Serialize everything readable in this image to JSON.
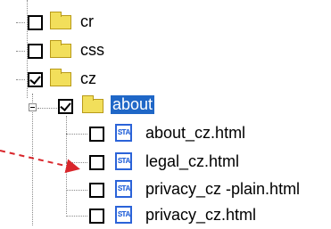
{
  "tree": {
    "items": [
      {
        "label": "cr",
        "checked": false,
        "type": "folder"
      },
      {
        "label": "css",
        "checked": false,
        "type": "folder"
      },
      {
        "label": "cz",
        "checked": true,
        "type": "folder"
      },
      {
        "label": "about",
        "checked": true,
        "type": "folder",
        "selected": true,
        "expanded": true
      },
      {
        "label": "about_cz.html",
        "checked": false,
        "type": "file"
      },
      {
        "label": "legal_cz.html",
        "checked": false,
        "type": "file"
      },
      {
        "label": "privacy_cz -plain.html",
        "checked": false,
        "type": "file"
      },
      {
        "label": "privacy_cz.html",
        "checked": false,
        "type": "file"
      }
    ],
    "file_icon_text": "STA"
  },
  "colors": {
    "selection": "#1f67c7",
    "folder": "#f2df5b",
    "file_icon": "#2b63d8",
    "arrow": "#d9262b"
  }
}
